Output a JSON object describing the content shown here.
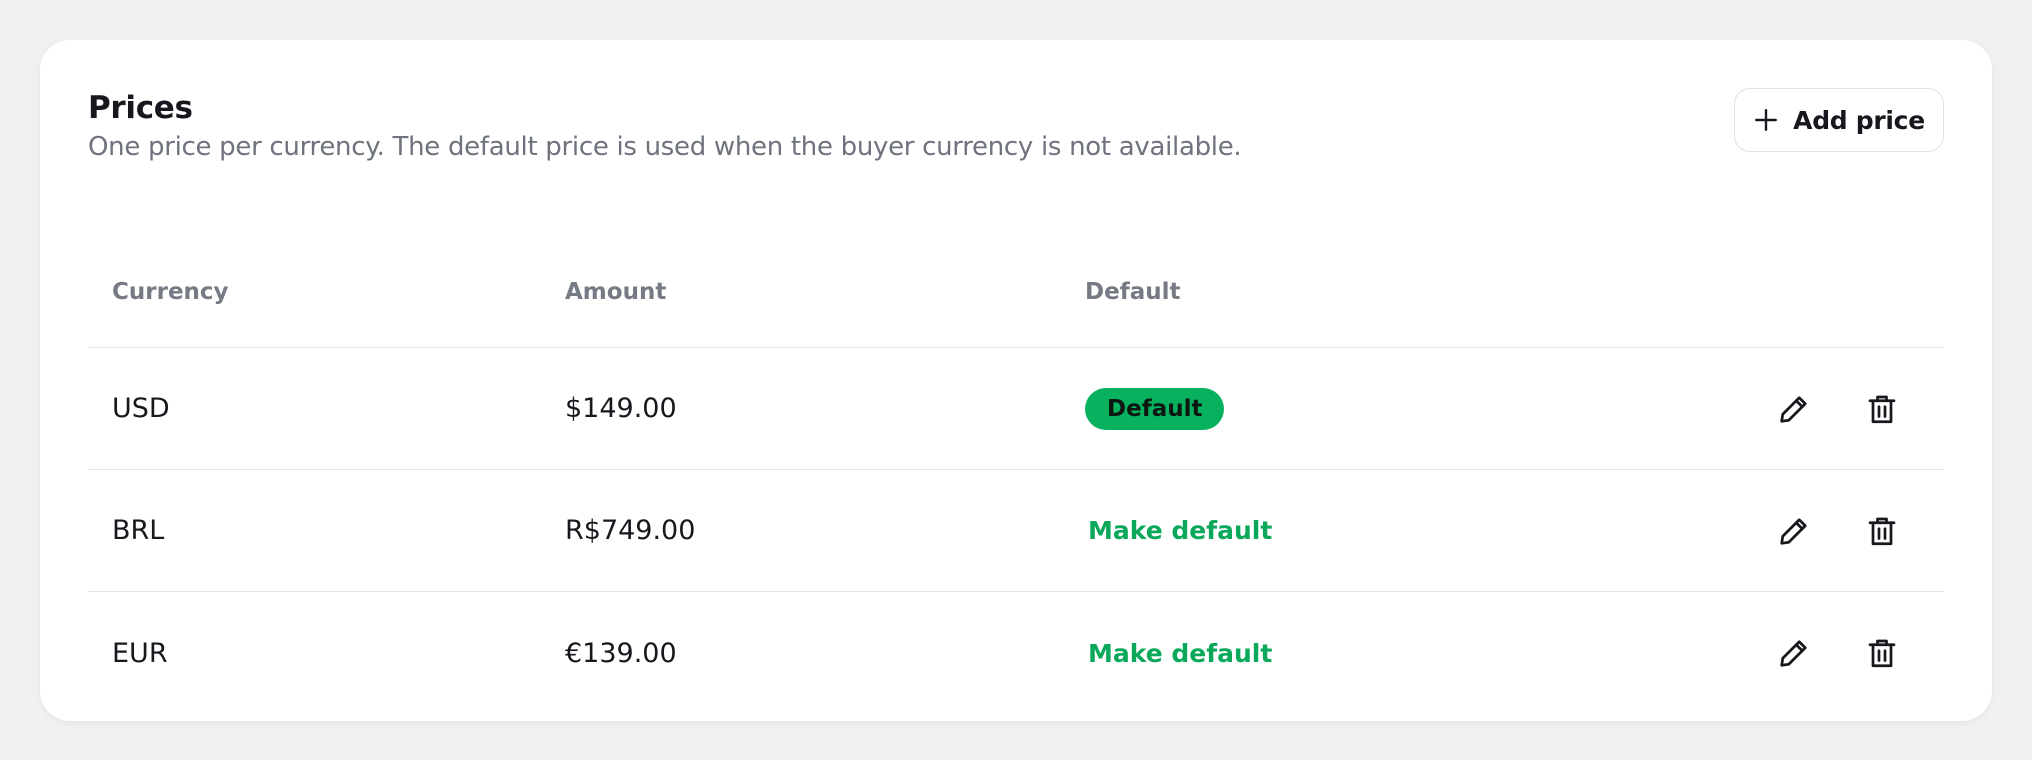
{
  "prices": {
    "title": "Prices",
    "subtitle": "One price per currency. The default price is used when the buyer currency is not available.",
    "add_label": "Add price",
    "columns": [
      "Currency",
      "Amount",
      "Default"
    ],
    "rows": [
      {
        "currency": "USD",
        "amount": "$149.00",
        "default_label": "Default",
        "is_default": true
      },
      {
        "currency": "BRL",
        "amount": "R$749.00",
        "default_label": "Make default",
        "is_default": false
      },
      {
        "currency": "EUR",
        "amount": "€139.00",
        "default_label": "Make default",
        "is_default": false
      }
    ]
  },
  "colors": {
    "accent": "#08b15e",
    "link": "#0aa85a",
    "background": "#eff0f2"
  },
  "icons": [
    "plus-icon",
    "pencil-icon",
    "trash-icon"
  ]
}
